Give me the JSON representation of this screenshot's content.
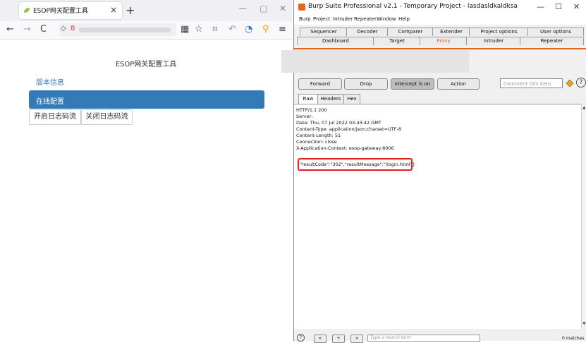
{
  "firefox": {
    "tab_title": "ESOP网关配置工具",
    "tab_close": "×",
    "new_tab": "+",
    "window_controls": [
      "—",
      "▢",
      "✕"
    ],
    "nav_icons": [
      "back-icon",
      "forward-icon",
      "reload-icon",
      "shield-icon",
      "lock-icon",
      "qr-icon",
      "star-icon",
      "crop-icon",
      "undo-icon",
      "extension-icon",
      "key-icon",
      "menu-icon"
    ],
    "nav_glyphs": [
      "←",
      "→",
      "C",
      "◇",
      "8",
      "▦",
      "☆",
      "⌗",
      "↶",
      "◔",
      "⚲",
      "≡"
    ]
  },
  "page": {
    "title": "ESOP网关配置工具",
    "version_link": "版本信息",
    "online_config": "在线配置",
    "open_log": "开启日志码流",
    "close_log": "关闭日志码流",
    "accent": "#337ab7"
  },
  "burp": {
    "title": "Burp Suite Professional v2.1 - Temporary Project - lasdasldkaldksa",
    "window_controls": [
      "—",
      "☐",
      "✕"
    ],
    "menu": [
      "Burp",
      "Project",
      "Intruder",
      "Repeater",
      "Window",
      "Help"
    ],
    "tabs_row1": [
      "Sequencer",
      "Decoder",
      "Comparer",
      "Extender",
      "Project options",
      "User options"
    ],
    "tabs_row2": [
      "Dashboard",
      "Target",
      "Proxy",
      "Intruder",
      "Repeater"
    ],
    "buttons": {
      "forward": "Forward",
      "drop": "Drop",
      "intercept": "Intercept is on",
      "action": "Action"
    },
    "comment_placeholder": "Comment this item",
    "view_tabs": [
      "Raw",
      "Headers",
      "Hex"
    ],
    "response_lines": [
      "HTTP/1.1 200",
      "Server:",
      "Date: Thu, 07 Jul 2022 03:43:42 GMT",
      "Content-Type: application/json;charset=UTF-8",
      "Content-Length: 51",
      "Connection: close",
      "X-Application-Context: esop-gateway:8006"
    ],
    "response_body": "{\"resultCode\":\"302\",\"resultMessage\":\"/login.html\"}",
    "search_placeholder": "Type a search term",
    "matches": "0 matches",
    "nav_buttons": [
      "<",
      "+",
      ">"
    ],
    "help_icon": "?",
    "accent": "#e8631e"
  }
}
